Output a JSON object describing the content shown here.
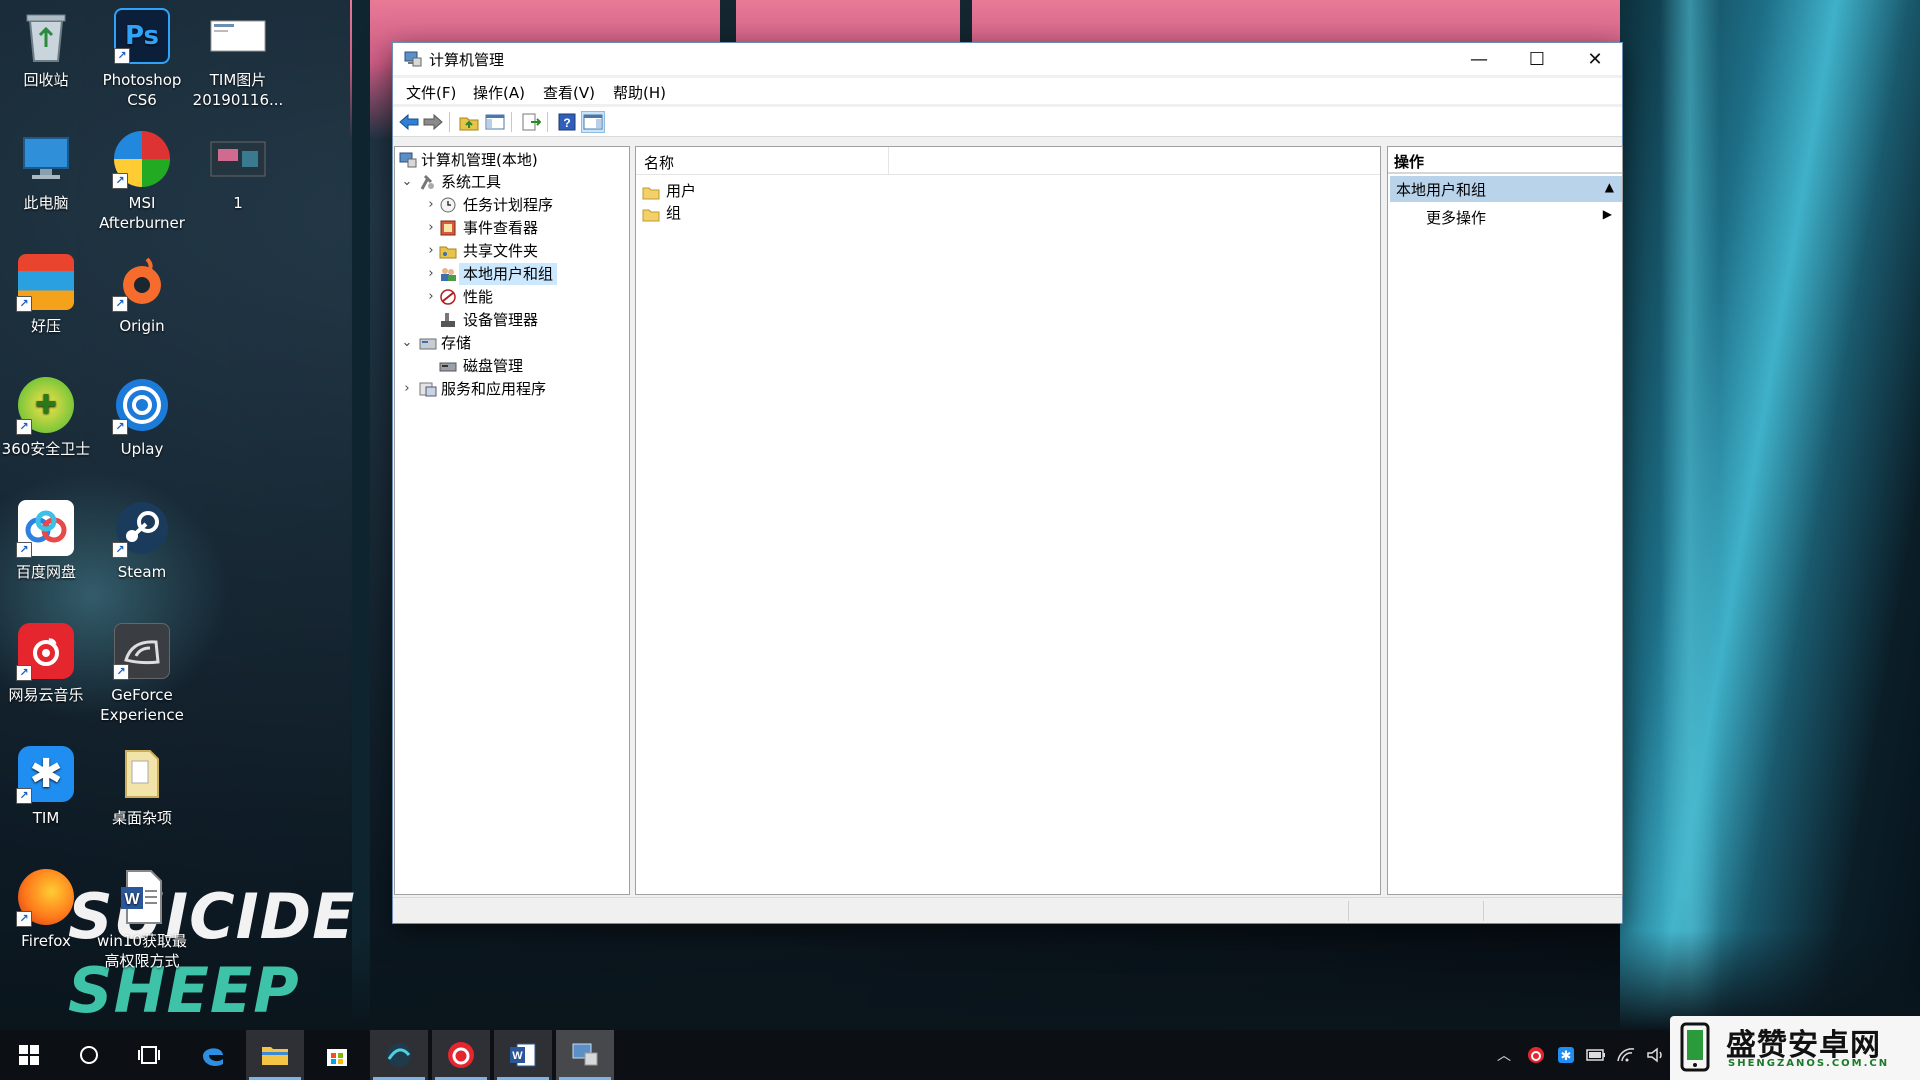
{
  "desktop": {
    "icons": [
      {
        "label": "回收站",
        "icon": "recycle-bin-icon"
      },
      {
        "label": "Photoshop\nCS6",
        "icon": "photoshop-icon"
      },
      {
        "label": "TIM图片\n20190116...",
        "icon": "image-file-icon"
      },
      {
        "label": "此电脑",
        "icon": "this-pc-icon"
      },
      {
        "label": "MSI\nAfterburner",
        "icon": "msi-afterburner-icon"
      },
      {
        "label": "1",
        "icon": "image-file-icon"
      },
      {
        "label": "好压",
        "icon": "haozip-icon"
      },
      {
        "label": "Origin",
        "icon": "origin-icon"
      },
      {
        "label": "360安全卫士",
        "icon": "360-security-icon"
      },
      {
        "label": "Uplay",
        "icon": "uplay-icon"
      },
      {
        "label": "百度网盘",
        "icon": "baidu-netdisk-icon"
      },
      {
        "label": "Steam",
        "icon": "steam-icon"
      },
      {
        "label": "网易云音乐",
        "icon": "netease-music-icon"
      },
      {
        "label": "GeForce\nExperience",
        "icon": "geforce-experience-icon"
      },
      {
        "label": "TIM",
        "icon": "tim-icon"
      },
      {
        "label": "桌面杂项",
        "icon": "folder-icon"
      },
      {
        "label": "Firefox",
        "icon": "firefox-icon"
      },
      {
        "label": "win10获取最\n高权限方式",
        "icon": "word-document-icon"
      }
    ],
    "wallpaper_text": [
      "SUICIDE",
      "SHEEP"
    ]
  },
  "window": {
    "title": "计算机管理",
    "controls": {
      "minimize": "—",
      "maximize": "☐",
      "close": "✕"
    },
    "menu": [
      "文件(F)",
      "操作(A)",
      "查看(V)",
      "帮助(H)"
    ],
    "toolbar": [
      "back-icon",
      "forward-icon",
      "up-folder-icon",
      "show-hide-tree-icon",
      "export-list-icon",
      "help-icon",
      "show-hide-action-pane-icon"
    ],
    "tree": [
      {
        "label": "计算机管理(本地)",
        "icon": "computer-management-icon",
        "level": 0,
        "expander": ""
      },
      {
        "label": "系统工具",
        "icon": "system-tools-icon",
        "level": 1,
        "expander": "expanded"
      },
      {
        "label": "任务计划程序",
        "icon": "task-scheduler-icon",
        "level": 2,
        "expander": "collapsed"
      },
      {
        "label": "事件查看器",
        "icon": "event-viewer-icon",
        "level": 2,
        "expander": "collapsed"
      },
      {
        "label": "共享文件夹",
        "icon": "shared-folders-icon",
        "level": 2,
        "expander": "collapsed"
      },
      {
        "label": "本地用户和组",
        "icon": "local-users-groups-icon",
        "level": 2,
        "expander": "collapsed",
        "selected": true
      },
      {
        "label": "性能",
        "icon": "performance-icon",
        "level": 2,
        "expander": "collapsed"
      },
      {
        "label": "设备管理器",
        "icon": "device-manager-icon",
        "level": 2,
        "expander": ""
      },
      {
        "label": "存储",
        "icon": "storage-icon",
        "level": 1,
        "expander": "expanded"
      },
      {
        "label": "磁盘管理",
        "icon": "disk-management-icon",
        "level": 2,
        "expander": ""
      },
      {
        "label": "服务和应用程序",
        "icon": "services-apps-icon",
        "level": 1,
        "expander": "collapsed"
      }
    ],
    "list": {
      "column_header": "名称",
      "items": [
        "用户",
        "组"
      ]
    },
    "actions": {
      "header": "操作",
      "section": "本地用户和组",
      "item": "更多操作"
    }
  },
  "taskbar": {
    "items": [
      "windows-start-icon",
      "cortana-search-icon",
      "task-view-icon",
      "edge-icon",
      "file-explorer-icon",
      "store-icon",
      "browser-icon",
      "netease-music-icon",
      "word-icon",
      "computer-management-icon"
    ],
    "tray": [
      "show-hidden-icons-chevron",
      "netease-music-tray-icon",
      "tim-tray-icon",
      "battery-icon",
      "wifi-icon",
      "volume-icon"
    ]
  },
  "watermark": {
    "cn": "盛赞安卓网",
    "en": "SHENGZANOS.COM.CN"
  }
}
